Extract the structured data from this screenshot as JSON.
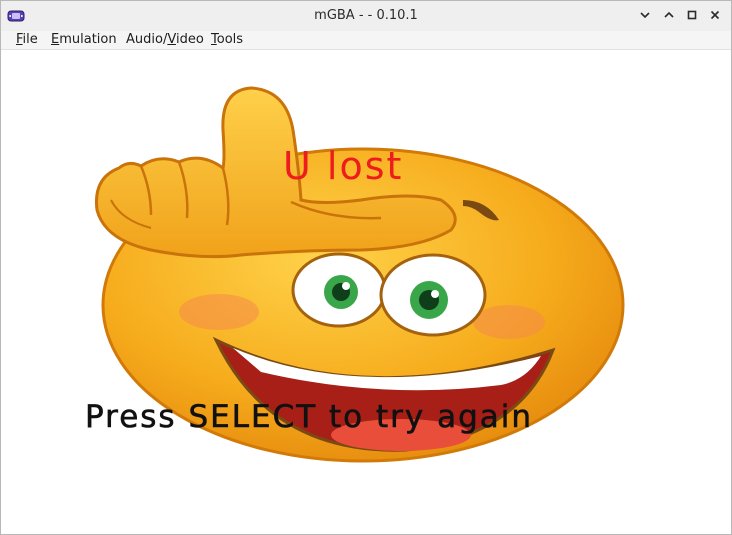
{
  "window": {
    "title": "mGBA -  - 0.10.1",
    "controls": {
      "minimize": "chevron-down-icon",
      "maximize": "chevron-up-icon",
      "restore": "square-icon",
      "close": "close-icon"
    }
  },
  "menubar": {
    "items": [
      {
        "mnemonic": "F",
        "rest": "ile"
      },
      {
        "mnemonic": "E",
        "rest": "mulation"
      },
      {
        "prefix": "Audio/",
        "mnemonic": "V",
        "rest": "ideo"
      },
      {
        "mnemonic": "T",
        "rest": "ools"
      }
    ]
  },
  "game": {
    "top_text": "U lost",
    "bottom_text": "Press SELECT to try again",
    "image": "laughing-loser-emoji",
    "colors": {
      "top_text": "#ee1c1c",
      "bottom_text": "#111111",
      "face": "#f7b21f",
      "face_shadow": "#e08a10",
      "eye_iris": "#3aa64a",
      "mouth": "#a81f18",
      "background": "#ffffff"
    }
  }
}
